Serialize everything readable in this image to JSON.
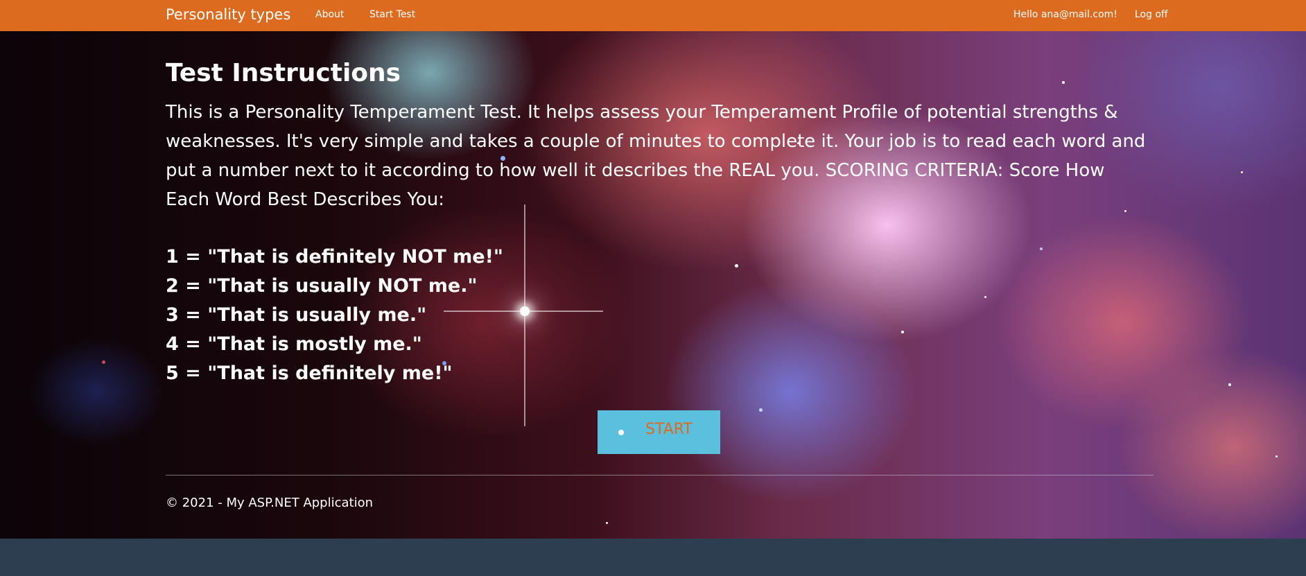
{
  "navbar": {
    "brand": "Personality types",
    "links": [
      "About",
      "Start Test"
    ],
    "greeting": "Hello ana@mail.com!",
    "logoff": "Log off",
    "color": "#dd6b1f"
  },
  "main": {
    "title": "Test Instructions",
    "intro": "This is a Personality Temperament Test. It helps assess your Temperament Profile of potential strengths & weaknesses. It's very simple and takes a couple of minutes to complete it. Your job is to read each word and put a number next to it according to how well it describes the REAL you. SCORING CRITERIA: Score How Each Word Best Describes You:",
    "scores": [
      "1 = \"That is definitely NOT me!\"",
      "2 = \"That is usually NOT me.\"",
      "3 = \"That is usually me.\"",
      "4 = \"That is mostly me.\"",
      "5 = \"That is definitely me!\""
    ],
    "start_label": "START",
    "start_color": "#5bc0de"
  },
  "footer": {
    "text": "© 2021 - My ASP.NET Application"
  },
  "background": {
    "image": "nebula starfield",
    "page_bottom_color": "#2c3e50"
  }
}
